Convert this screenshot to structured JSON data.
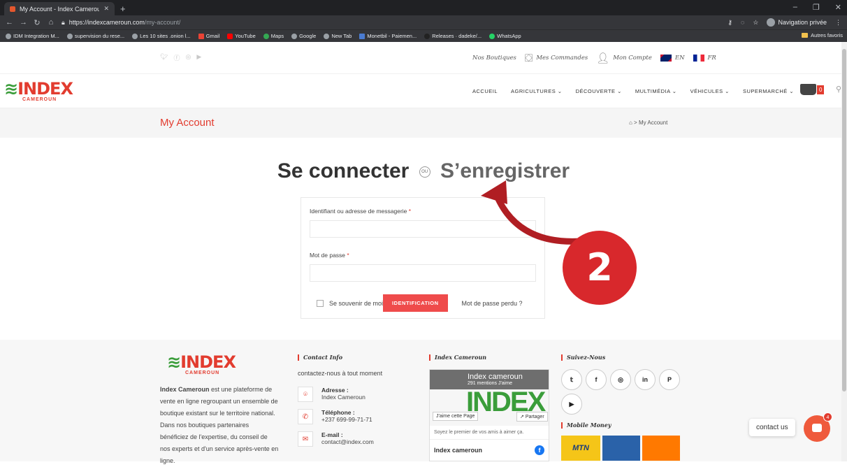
{
  "browser": {
    "tab_title": "My Account - Index Cameroun",
    "url_host": "https://indexcameroun.com",
    "url_path": "/my-account/",
    "profile_label": "Navigation privée",
    "bookmarks": [
      "IDM Integration M...",
      "supervision du rese...",
      "Les 10 sites .onion l...",
      "Gmail",
      "YouTube",
      "Maps",
      "Google",
      "New Tab",
      "Monetbil - Paiemen...",
      "Releases · dadeke/...",
      "WhatsApp"
    ],
    "other_bookmarks": "Autres favoris"
  },
  "topbar": {
    "links": [
      "Nos Boutiques",
      "Mes Commandes",
      "Mon Compte"
    ],
    "lang_en": "EN",
    "lang_fr": "FR"
  },
  "logo": {
    "name": "INDEX",
    "sub": "CAMEROUN"
  },
  "menu": [
    "ACCUEIL",
    "AGRICULTURES ⌄",
    "DÉCOUVERTE ⌄",
    "MULTIMÉDIA ⌄",
    "VÉHICULES ⌄",
    "SUPERMARCHÉ ⌄"
  ],
  "cart": {
    "count": "0"
  },
  "page": {
    "title": "My Account",
    "breadcrumb": "⌂ > My Account"
  },
  "auth": {
    "login": "Se connecter",
    "ou": "OU",
    "register": "S’enregistrer",
    "username_label": "Identifiant ou adresse de messagerie",
    "password_label": "Mot de passe",
    "required_mark": "*",
    "remember": "Se souvenir de moi",
    "submit": "IDENTIFICATION",
    "lost_password": "Mot de passe perdu ?"
  },
  "annotation": {
    "number": "2"
  },
  "footer": {
    "about_bold": "Index Cameroun",
    "about_text": "est une plateforme de vente en ligne regroupant un ensemble de boutique existant sur le territoire national. Dans nos boutiques partenaires bénéficiez de l'expertise, du conseil de nos experts et d'un service après-vente en ligne.",
    "contact_head": "Contact Info",
    "contact_intro": "contactez-nous à tout moment",
    "address_label": "Adresse :",
    "address_value": "Index Cameroun",
    "phone_label": "Téléphone :",
    "phone_value": "+237 699-99-71-71",
    "email_label": "E-mail :",
    "email_value": "contact@index.com",
    "fb_head": "Index Cameroun",
    "fb_page_name": "Index cameroun",
    "fb_likes": "291 mentions J'aime",
    "fb_big": "INDEX",
    "fb_like_btn": "J'aime cette Page",
    "fb_share_btn": "Partager",
    "fb_sub": "Soyez le premier de vos amis à aimer ça.",
    "fb_post_name": "Index cameroun",
    "follow_head": "Suivez-Nous",
    "socials": [
      "𝕥",
      "f",
      "◎",
      "in",
      "P",
      "▶"
    ],
    "mobile_money_head": "Mobile Money",
    "mtn": "MTN"
  },
  "widget": {
    "contact_us": "contact us",
    "notif": "4"
  }
}
